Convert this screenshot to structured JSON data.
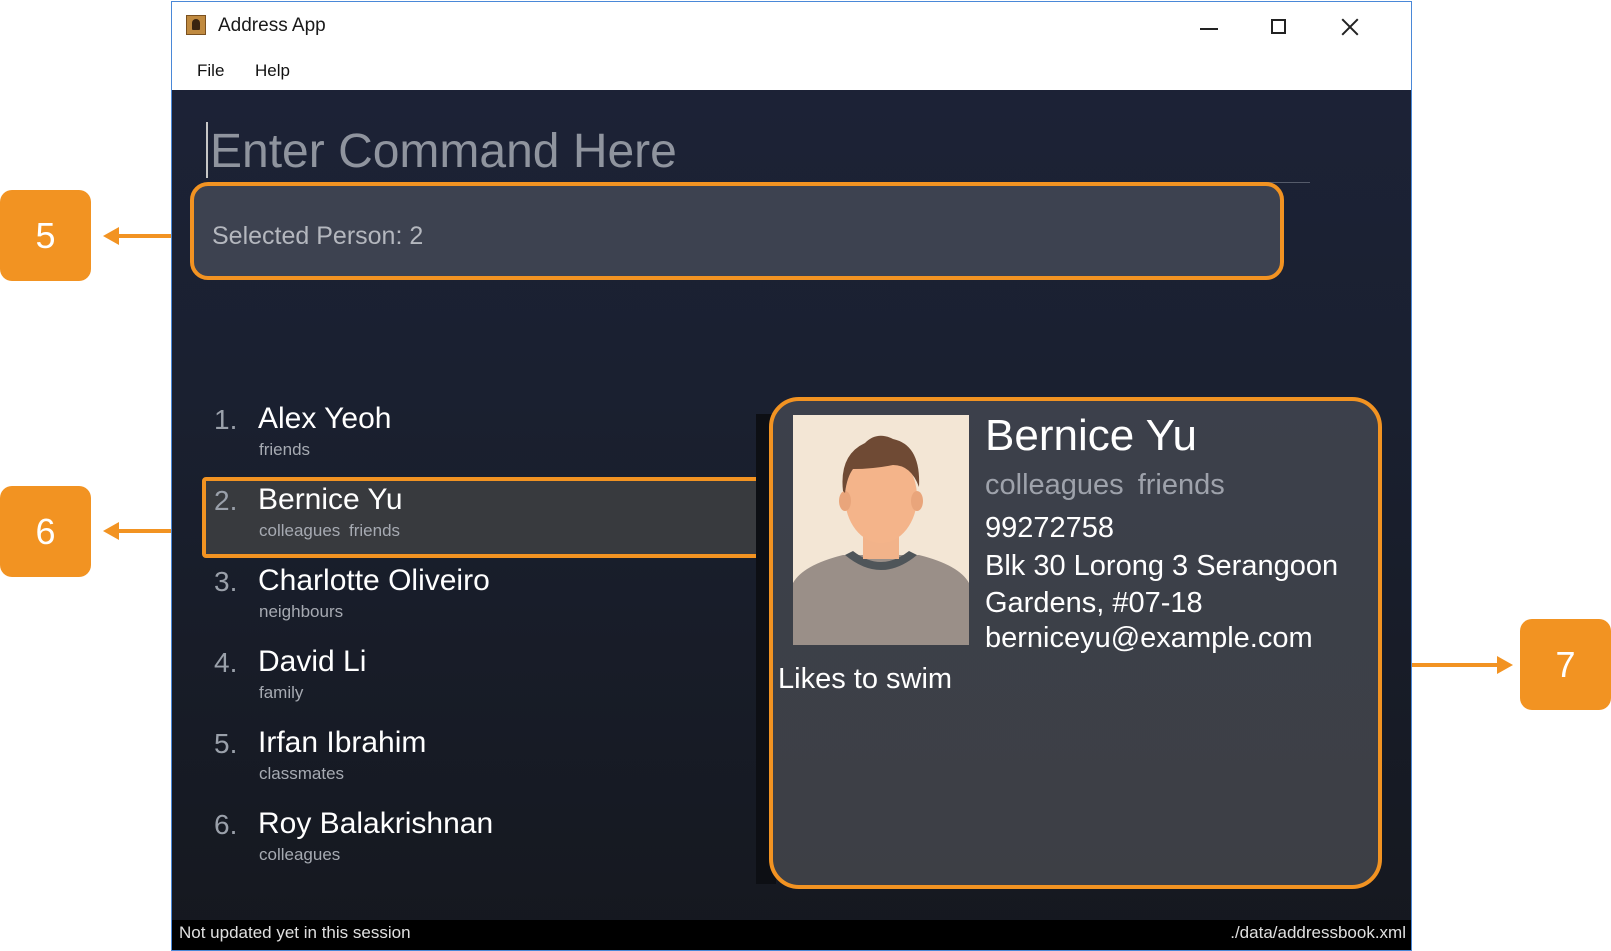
{
  "window": {
    "title": "Address App",
    "icon": "address-book-icon"
  },
  "menu": {
    "items": [
      "File",
      "Help"
    ]
  },
  "command": {
    "placeholder": "Enter Command Here",
    "value": ""
  },
  "result": {
    "text": "Selected Person: 2"
  },
  "persons": [
    {
      "index": "1.",
      "name": "Alex Yeoh",
      "tags": "friends"
    },
    {
      "index": "2.",
      "name": "Bernice Yu",
      "tags": "colleagues friends"
    },
    {
      "index": "3.",
      "name": "Charlotte Oliveiro",
      "tags": "neighbours"
    },
    {
      "index": "4.",
      "name": "David Li",
      "tags": "family"
    },
    {
      "index": "5.",
      "name": "Irfan Ibrahim",
      "tags": "classmates"
    },
    {
      "index": "6.",
      "name": "Roy Balakrishnan",
      "tags": "colleagues"
    }
  ],
  "selected_index": 1,
  "detail": {
    "name": "Bernice Yu",
    "tags": "colleagues friends",
    "phone": "99272758",
    "address": "Blk 30 Lorong 3 Serangoon Gardens, #07-18",
    "email": "berniceyu@example.com",
    "remark": "Likes to swim"
  },
  "status": {
    "left": "Not updated yet in this session",
    "right": "./data/addressbook.xml"
  },
  "callouts": [
    "5",
    "6",
    "7"
  ],
  "colors": {
    "accent": "#f29322",
    "background": "#1c2236",
    "card": "#3d4250"
  }
}
